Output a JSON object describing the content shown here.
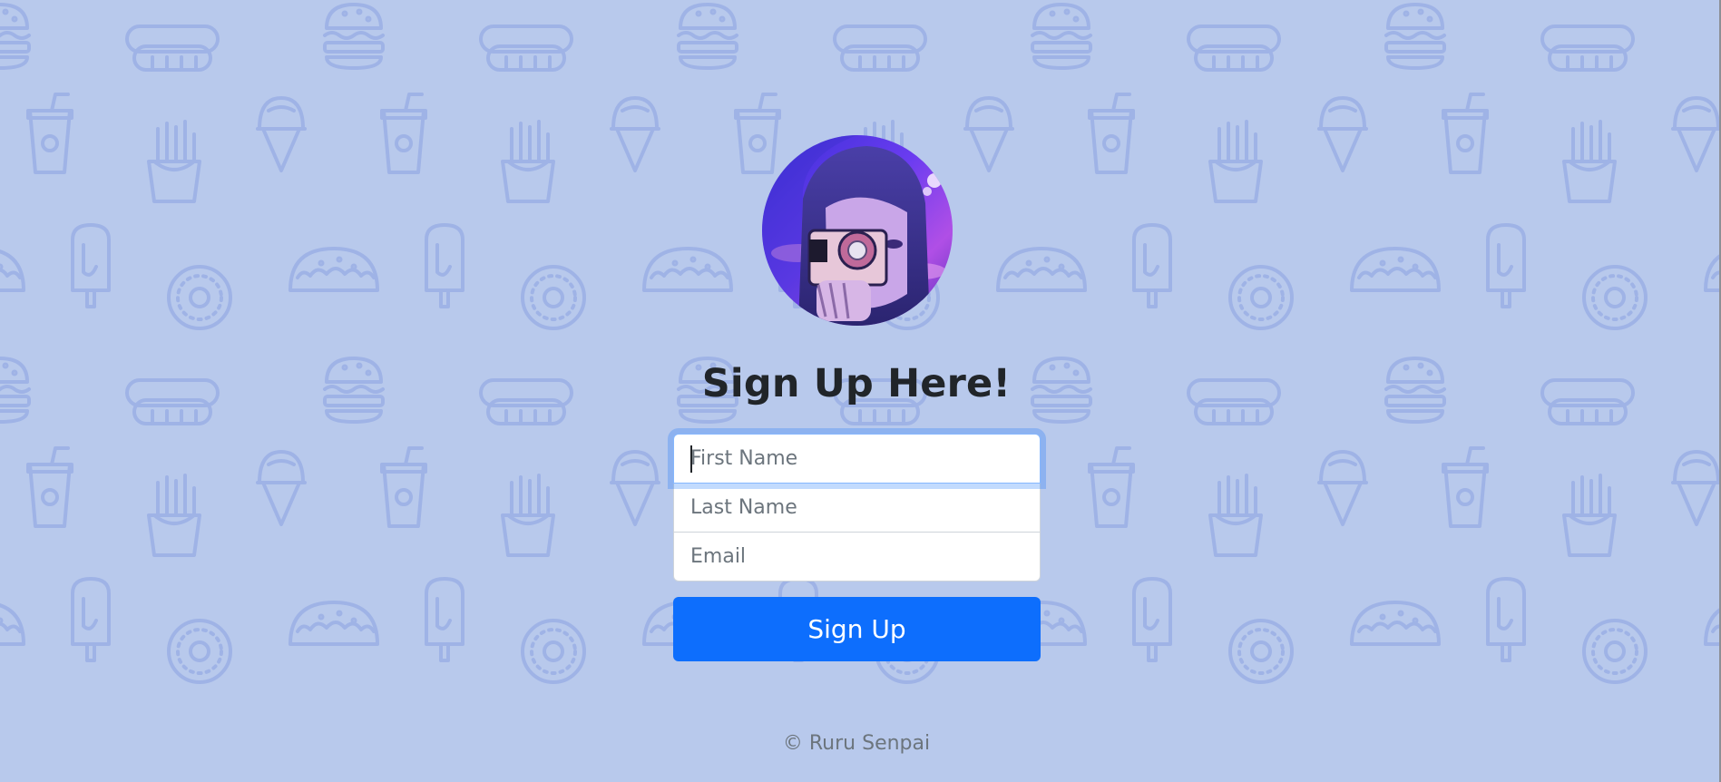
{
  "page": {
    "background_color": "#b8c9ec",
    "pattern_color": "#9fb3e6",
    "pattern_icons": [
      "hamburger-icon",
      "hot-dog-icon",
      "soda-cup-icon",
      "ice-cream-cone-icon",
      "french-fries-icon",
      "popsicle-icon",
      "taco-icon",
      "donut-icon"
    ]
  },
  "avatar": {
    "icon": "anime-avatar-image"
  },
  "heading": "Sign Up Here!",
  "form": {
    "first_name_placeholder": "First Name",
    "last_name_placeholder": "Last Name",
    "email_placeholder": "Email",
    "submit_label": "Sign Up",
    "focused_field": "first_name"
  },
  "footer": {
    "text": "© Ruru Senpai"
  },
  "colors": {
    "primary": "#0d6efd",
    "heading": "#212529",
    "muted": "#6c757d",
    "focus_ring": "#86b7fe"
  }
}
